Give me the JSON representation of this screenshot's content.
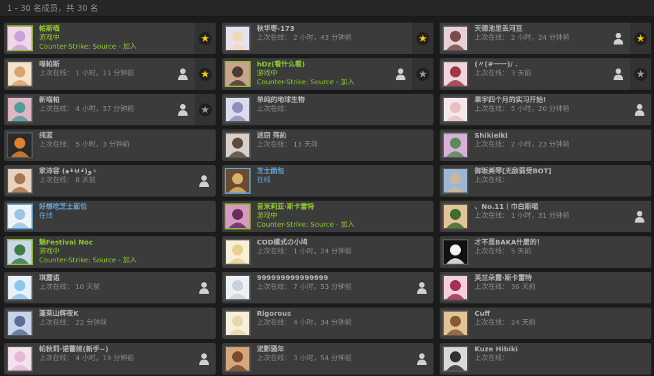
{
  "header": {
    "title": "1 - 30 名成员，共 30 名"
  },
  "colors": {
    "ingame": "#8fcb2b",
    "online": "#64a6dc",
    "offline": "#b4b4b4",
    "star": "#ffc800"
  },
  "members": [
    {
      "name": "帕斯喵",
      "status": "ingame",
      "l1": "游戏中",
      "l2": "Counter-Strike: Source - 加入",
      "star": "gold",
      "person": false
    },
    {
      "name": "秋华枣-173",
      "status": "offline",
      "l1": "上次在线： 2 小时，43 分钟前",
      "l2": "",
      "star": "gold",
      "person": false
    },
    {
      "name": "天德池里丢河豆",
      "status": "offline",
      "l1": "上次在线： 2 小时，24 分钟前",
      "l2": "",
      "star": "gold",
      "person": true
    },
    {
      "name": "喵帕斯",
      "status": "offline",
      "l1": "上次在线： 1 小时，11 分钟前",
      "l2": "",
      "star": "gold",
      "person": true
    },
    {
      "name": "hDz(看什么看)",
      "status": "ingame",
      "l1": "游戏中",
      "l2": "Counter-Strike: Source - 加入",
      "star": "gray",
      "person": true
    },
    {
      "name": "(〃(#一一)/ .",
      "status": "offline",
      "l1": "上次在线： 3 天前",
      "l2": "",
      "star": "gray",
      "person": true
    },
    {
      "name": "新喵帕",
      "status": "offline",
      "l1": "上次在线： 4 小时，37 分钟前",
      "l2": "",
      "star": "gray",
      "person": true
    },
    {
      "name": "单纯的地球生物",
      "status": "offline",
      "l1": "上次在线：",
      "l2": "",
      "star": "none",
      "person": false
    },
    {
      "name": "果宇四个月的实习开始!",
      "status": "offline",
      "l1": "上次在线： 5 小时，20 分钟前",
      "l2": "",
      "star": "none",
      "person": true
    },
    {
      "name": "纯蓝",
      "status": "offline",
      "l1": "上次在线： 5 小时，3 分钟前",
      "l2": "",
      "star": "none",
      "person": false
    },
    {
      "name": "迷窃 殇訫",
      "status": "offline",
      "l1": "上次在线： 13 天前",
      "l2": "",
      "star": "none",
      "person": false
    },
    {
      "name": "Shikieiki",
      "status": "offline",
      "l1": "上次在线： 2 小时，23 分钟前",
      "l2": "",
      "star": "none",
      "person": false
    },
    {
      "name": "家沛容 (๑•̀ㅂ•́)و✧",
      "status": "offline",
      "l1": "上次在线： 8 天前",
      "l2": "",
      "star": "none",
      "person": true
    },
    {
      "name": "芝士面包",
      "status": "online",
      "l1": "在线",
      "l2": "",
      "star": "none",
      "person": false
    },
    {
      "name": "御坂美琴[无敌弱受BOT]",
      "status": "offline",
      "l1": "上次在线：",
      "l2": "",
      "star": "none",
      "person": false
    },
    {
      "name": "好想吃芝士面包",
      "status": "online",
      "l1": "在线",
      "l2": "",
      "star": "none",
      "person": false
    },
    {
      "name": "音米莉亚·斯卡雷特",
      "status": "ingame",
      "l1": "游戏中",
      "l2": "Counter-Strike: Source - 加入",
      "star": "none",
      "person": false
    },
    {
      "name": "、No.11丨巾白斯喵",
      "status": "offline",
      "l1": "上次在线： 1 小时，31 分钟前",
      "l2": "",
      "star": "none",
      "person": true
    },
    {
      "name": "魅Festival Noc",
      "status": "ingame",
      "l1": "游戏中",
      "l2": "Counter-Strike: Source - 加入",
      "star": "none",
      "person": false
    },
    {
      "name": "COD模式の小鸠",
      "status": "offline",
      "l1": "上次在线： 1 小时，24 分钟前",
      "l2": "",
      "star": "none",
      "person": false
    },
    {
      "name": "才不是BAKA什麼的！",
      "status": "offline",
      "l1": "上次在线： 5 天前",
      "l2": "",
      "star": "none",
      "person": false
    },
    {
      "name": "琪露诺",
      "status": "offline",
      "l1": "上次在线： 10 天前",
      "l2": "",
      "star": "none",
      "person": true
    },
    {
      "name": "999999999999999",
      "status": "offline",
      "l1": "上次在线： 7 小时，53 分钟前",
      "l2": "",
      "star": "none",
      "person": true
    },
    {
      "name": "芙兰朵露·斯卡雷特",
      "status": "offline",
      "l1": "上次在线： 36 天前",
      "l2": "",
      "star": "none",
      "person": false
    },
    {
      "name": "蓬莱山辉夜K",
      "status": "offline",
      "l1": "上次在线： 22 分钟前",
      "l2": "",
      "star": "none",
      "person": false
    },
    {
      "name": "Rigorous",
      "status": "offline",
      "l1": "上次在线： 4 小时，34 分钟前",
      "l2": "",
      "star": "none",
      "person": false
    },
    {
      "name": "Cuff",
      "status": "offline",
      "l1": "上次在线： 24 天前",
      "l2": "",
      "star": "none",
      "person": false
    },
    {
      "name": "帕秋莉·诺蕾姬(新手~)",
      "status": "offline",
      "l1": "上次在线： 4 小时，19 分钟前",
      "l2": "",
      "star": "none",
      "person": true
    },
    {
      "name": "泥影骚年",
      "status": "offline",
      "l1": "上次在线： 3 小时，54 分钟前",
      "l2": "",
      "star": "none",
      "person": true
    },
    {
      "name": "Kuze Hibiki",
      "status": "offline",
      "l1": "上次在线：",
      "l2": "",
      "star": "none",
      "person": false
    }
  ]
}
